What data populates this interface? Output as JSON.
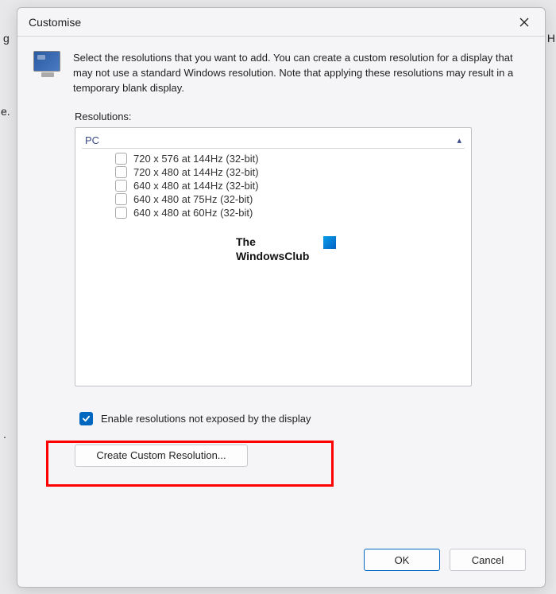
{
  "bg": {
    "left1": "g",
    "left2": "e.",
    "left3": ".",
    "right1": "n H"
  },
  "dialog": {
    "title": "Customise",
    "description": "Select the resolutions that you want to add. You can create a custom resolution for a display that may not use a standard Windows resolution. Note that applying these resolutions may result in a temporary blank display.",
    "resolutions_label": "Resolutions:",
    "pc_group": "PC",
    "resolutions": [
      "720 x 576 at 144Hz (32-bit)",
      "720 x 480 at 144Hz (32-bit)",
      "640 x 480 at 144Hz (32-bit)",
      "640 x 480 at 75Hz (32-bit)",
      "640 x 480 at 60Hz (32-bit)"
    ],
    "checkbox_label": "Enable resolutions not exposed by the display",
    "checkbox_checked": true,
    "create_button": "Create Custom Resolution...",
    "ok_button": "OK",
    "cancel_button": "Cancel"
  },
  "watermark": {
    "line1": "The",
    "line2": "WindowsClub"
  }
}
